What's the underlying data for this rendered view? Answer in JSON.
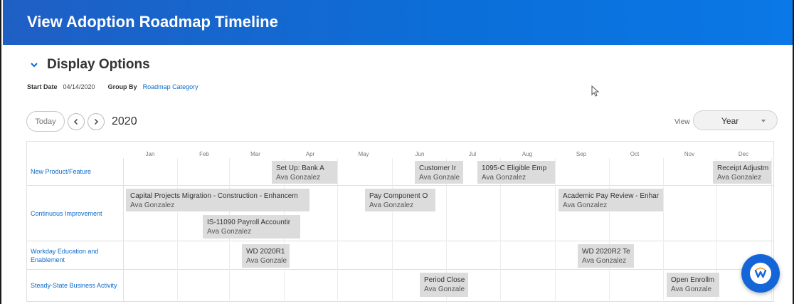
{
  "header": {
    "title": "View Adoption Roadmap Timeline"
  },
  "display_options": {
    "label": "Display Options"
  },
  "params": {
    "start_date_label": "Start Date",
    "start_date_value": "04/14/2020",
    "group_by_label": "Group By",
    "group_by_value": "Roadmap Category"
  },
  "toolbar": {
    "today_label": "Today",
    "year": "2020"
  },
  "view": {
    "label": "View",
    "selected": "Year"
  },
  "months": [
    "Jan",
    "Feb",
    "Mar",
    "Apr",
    "May",
    "Jun",
    "Jul",
    "Aug",
    "Sep",
    "Oct",
    "Nov",
    "Dec"
  ],
  "rows": [
    {
      "label": "New Product/Feature"
    },
    {
      "label": "Continuous Improvement"
    },
    {
      "label": "Workday Education and Enablement"
    },
    {
      "label": "Steady-State Business Activity"
    }
  ],
  "bars": [
    {
      "title": "Set Up: Bank A",
      "owner": "Ava Gonzalez"
    },
    {
      "title": "Customer Ir",
      "owner": "Ava Gonzale"
    },
    {
      "title": "1095-C Eligible Emp",
      "owner": "Ava Gonzalez"
    },
    {
      "title": "Receipt Adjustm",
      "owner": "Ava Gonzalez"
    },
    {
      "title": "Capital Projects Migration - Construction - Enhancem",
      "owner": "Ava Gonzalez"
    },
    {
      "title": "Pay Component O",
      "owner": "Ava Gonzalez"
    },
    {
      "title": "Academic Pay Review - Enhar",
      "owner": "Ava Gonzalez"
    },
    {
      "title": "IS-11090 Payroll Accountir",
      "owner": "Ava Gonzalez"
    },
    {
      "title": "WD 2020R1",
      "owner": "Ava Gonzale"
    },
    {
      "title": "WD 2020R2 Te",
      "owner": "Ava Gonzalez"
    },
    {
      "title": "Period Close",
      "owner": "Ava Gonzale"
    },
    {
      "title": "Open Enrollm",
      "owner": "Ava Gonzale"
    }
  ],
  "colors": {
    "header": "#0b6fd9",
    "link": "#0b6bcb",
    "bar": "#dcdcdc",
    "fab": "#1466d8"
  }
}
